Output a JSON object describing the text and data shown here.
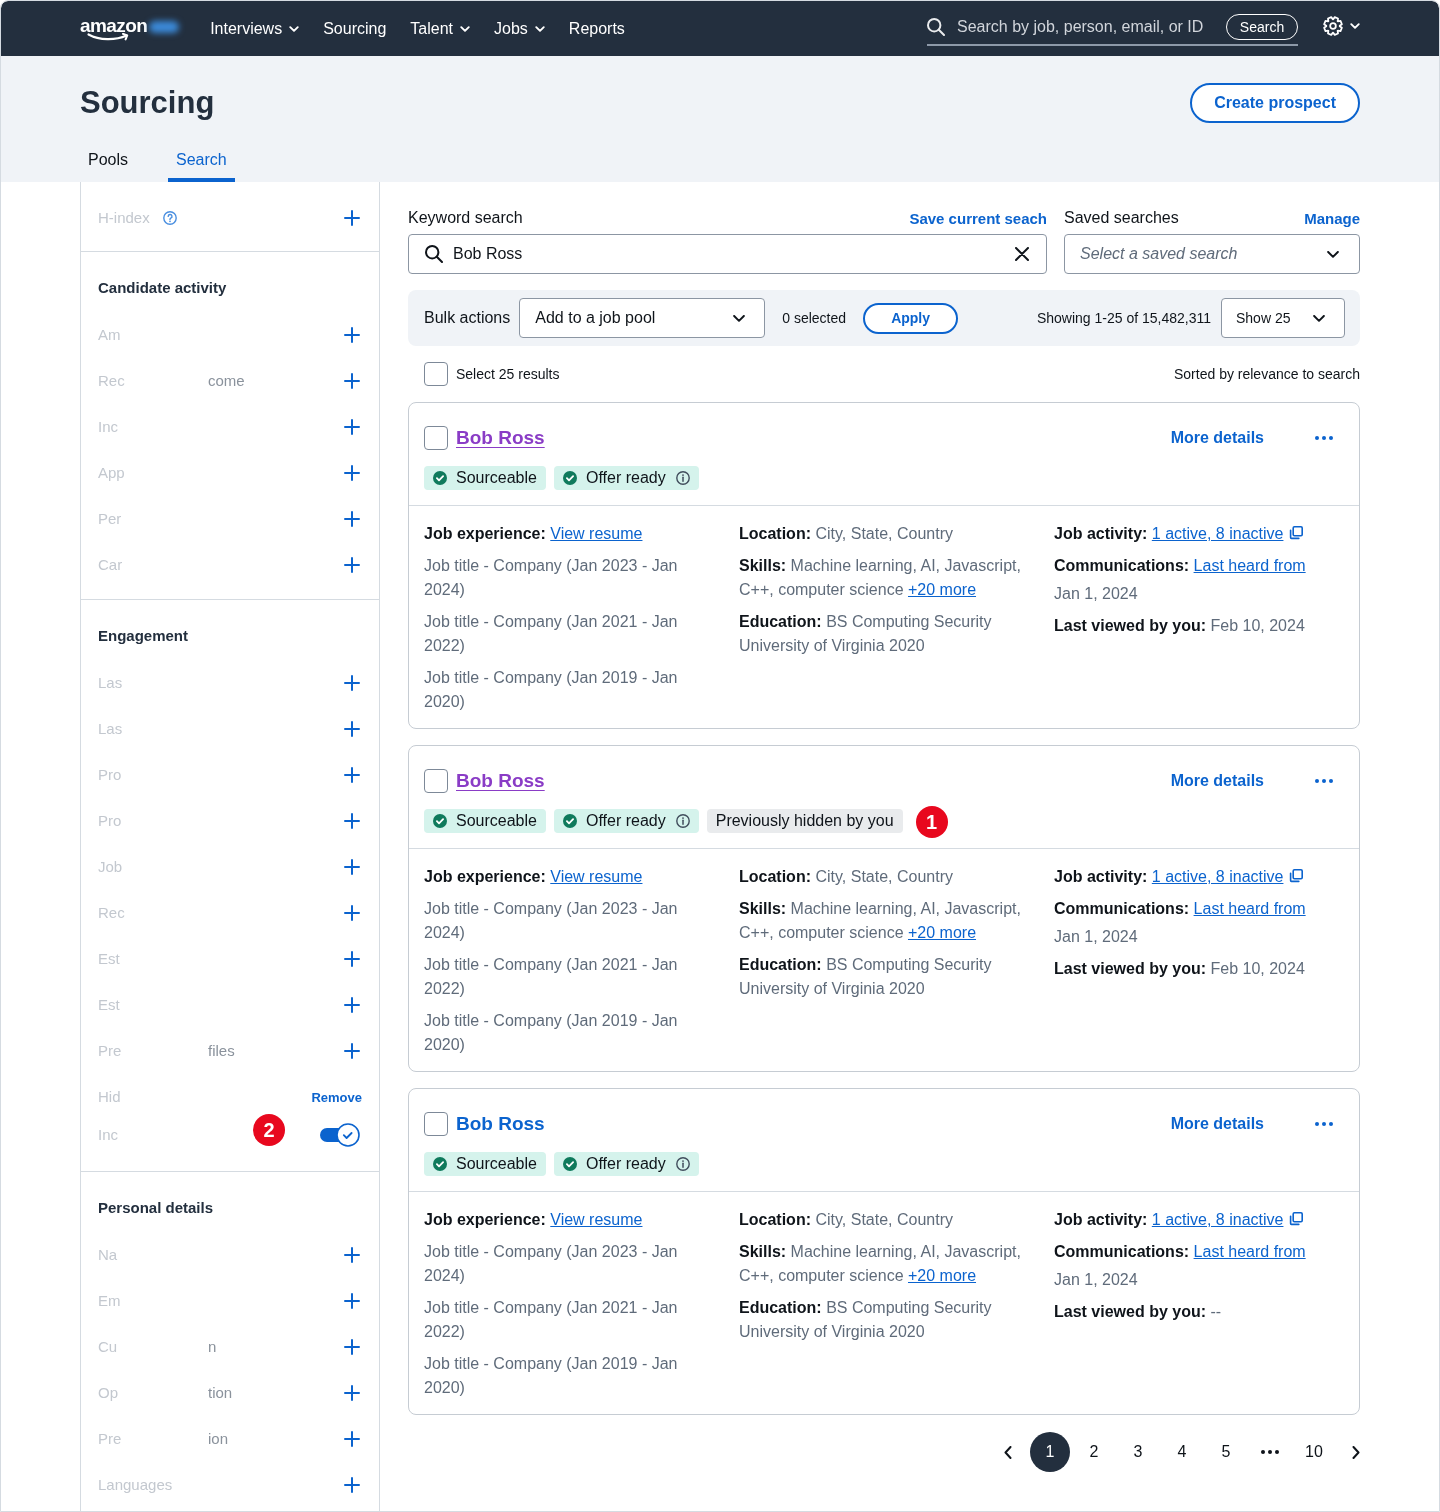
{
  "nav": {
    "logo": "amazon",
    "items": [
      {
        "label": "Interviews",
        "dropdown": true
      },
      {
        "label": "Sourcing",
        "dropdown": false
      },
      {
        "label": "Talent",
        "dropdown": true
      },
      {
        "label": "Jobs",
        "dropdown": true
      },
      {
        "label": "Reports",
        "dropdown": false
      }
    ],
    "search": {
      "placeholder": "Search by job, person, email, or ID",
      "button": "Search"
    }
  },
  "header": {
    "title": "Sourcing",
    "action": "Create prospect",
    "tabs": [
      {
        "label": "Pools",
        "selected": false
      },
      {
        "label": "Search",
        "selected": true
      }
    ]
  },
  "filters": {
    "sections": [
      {
        "items": [
          {
            "kind": "add",
            "label": "H-index",
            "help": true
          }
        ]
      },
      {
        "heading": "Candidate activity",
        "items": [
          {
            "kind": "add",
            "label": "Am"
          },
          {
            "kind": "add",
            "label": "Rec",
            "tail": "come"
          },
          {
            "kind": "add",
            "label": "Inc"
          },
          {
            "kind": "add",
            "label": "App"
          },
          {
            "kind": "add",
            "label": "Per"
          },
          {
            "kind": "add",
            "label": "Car"
          }
        ]
      },
      {
        "heading": "Engagement",
        "items": [
          {
            "kind": "add",
            "label": "Las"
          },
          {
            "kind": "add",
            "label": "Las"
          },
          {
            "kind": "add",
            "label": "Pro"
          },
          {
            "kind": "add",
            "label": "Pro"
          },
          {
            "kind": "add",
            "label": "Job"
          },
          {
            "kind": "add",
            "label": "Rec"
          },
          {
            "kind": "add",
            "label": "Est"
          },
          {
            "kind": "add",
            "label": "Est"
          },
          {
            "kind": "add",
            "label": "Pre",
            "tail": "files"
          },
          {
            "kind": "remove",
            "label": "Hid",
            "action": "Remove"
          },
          {
            "kind": "toggle",
            "label": "Inc",
            "on": true,
            "annotation": "2"
          }
        ]
      },
      {
        "heading": "Personal details",
        "items": [
          {
            "kind": "add",
            "label": "Na"
          },
          {
            "kind": "add",
            "label": "Em"
          },
          {
            "kind": "add",
            "label": "Cu",
            "tail": "n"
          },
          {
            "kind": "add",
            "label": "Op",
            "tail": "tion"
          },
          {
            "kind": "add",
            "label": "Pre",
            "tail": "ion"
          },
          {
            "kind": "add",
            "label": "Languages"
          }
        ]
      }
    ]
  },
  "keyword_search": {
    "label": "Keyword search",
    "link": "Save current seach",
    "value": "Bob Ross"
  },
  "saved_searches": {
    "label": "Saved searches",
    "link": "Manage",
    "placeholder": "Select a saved search"
  },
  "bulk_actions": {
    "label": "Bulk actions",
    "action": "Add to a job pool",
    "count": "0 selected",
    "button": "Apply",
    "showing": "Showing 1-25 of 15,482,311",
    "page_size": "Show 25"
  },
  "results": {
    "select_all": {
      "label": "Select 25 results",
      "checked": false
    },
    "sort": "Sorted by relevance to search",
    "cards": [
      {
        "name": "Bob Ross",
        "visited": true,
        "checked": false,
        "action": "More details",
        "tags": [
          {
            "kind": "status",
            "label": "Sourceable"
          },
          {
            "kind": "status",
            "label": "Offer ready",
            "info": true
          }
        ],
        "columns": [
          [
            {
              "label": "Job experience:",
              "link": "View resume"
            },
            {
              "value": "Job title - Company (Jan 2023 - Jan 2024)"
            },
            {
              "value": "Job title - Company (Jan 2021 - Jan 2022)"
            },
            {
              "value": "Job title - Company (Jan 2019 - Jan 2020)"
            }
          ],
          [
            {
              "label": "Location:",
              "value": "City, State, Country"
            },
            {
              "label": "Skills:",
              "value": "Machine learning, AI, Javascript, C++, computer science",
              "link": "+20 more"
            },
            {
              "label": "Education:",
              "value": "BS Computing Security University of Virginia 2020"
            }
          ],
          [
            {
              "label": "Job activity:",
              "link": "1 active, 8 inactive",
              "link_icon": true
            },
            {
              "label": "Communications:",
              "link": "Last heard from",
              "note": "Jan 1, 2024"
            },
            {
              "label": "Last viewed by you:",
              "value": "Feb 10, 2024"
            }
          ]
        ]
      },
      {
        "name": "Bob Ross",
        "visited": true,
        "checked": false,
        "action": "More details",
        "tags": [
          {
            "kind": "status",
            "label": "Sourceable"
          },
          {
            "kind": "status",
            "label": "Offer ready",
            "info": true
          },
          {
            "kind": "neutral",
            "label": "Previously hidden by you"
          }
        ],
        "annotation": "1",
        "columns": [
          [
            {
              "label": "Job experience:",
              "link": "View resume"
            },
            {
              "value": "Job title - Company (Jan 2023 - Jan 2024)"
            },
            {
              "value": "Job title - Company (Jan 2021 - Jan 2022)"
            },
            {
              "value": "Job title - Company (Jan 2019 - Jan 2020)"
            }
          ],
          [
            {
              "label": "Location:",
              "value": "City, State, Country"
            },
            {
              "label": "Skills:",
              "value": "Machine learning, AI, Javascript, C++, computer science",
              "link": "+20 more"
            },
            {
              "label": "Education:",
              "value": "BS Computing Security University of Virginia 2020"
            }
          ],
          [
            {
              "label": "Job activity:",
              "link": "1 active, 8 inactive",
              "link_icon": true
            },
            {
              "label": "Communications:",
              "link": "Last heard from",
              "note": "Jan 1, 2024"
            },
            {
              "label": "Last viewed by you:",
              "value": "Feb 10, 2024"
            }
          ]
        ]
      },
      {
        "name": "Bob Ross",
        "visited": false,
        "checked": false,
        "action": "More details",
        "tags": [
          {
            "kind": "status",
            "label": "Sourceable"
          },
          {
            "kind": "status",
            "label": "Offer ready",
            "info": true
          }
        ],
        "columns": [
          [
            {
              "label": "Job experience:",
              "link": "View resume"
            },
            {
              "value": "Job title - Company (Jan 2023 - Jan 2024)"
            },
            {
              "value": "Job title - Company (Jan 2021 - Jan 2022)"
            },
            {
              "value": "Job title - Company (Jan 2019 - Jan 2020)"
            }
          ],
          [
            {
              "label": "Location:",
              "value": "City, State, Country"
            },
            {
              "label": "Skills:",
              "value": "Machine learning, AI, Javascript, C++, computer science",
              "link": "+20 more"
            },
            {
              "label": "Education:",
              "value": "BS Computing Security University of Virginia 2020"
            }
          ],
          [
            {
              "label": "Job activity:",
              "link": "1 active, 8 inactive",
              "link_icon": true
            },
            {
              "label": "Communications:",
              "link": "Last heard from",
              "note": "Jan 1, 2024"
            },
            {
              "label": "Last viewed by you:",
              "value": "--"
            }
          ]
        ]
      }
    ]
  },
  "pagination": {
    "pages": [
      {
        "kind": "page",
        "label": "1",
        "selected": true
      },
      {
        "kind": "page",
        "label": "2",
        "selected": false
      },
      {
        "kind": "page",
        "label": "3",
        "selected": false
      },
      {
        "kind": "page",
        "label": "4",
        "selected": false
      },
      {
        "kind": "page",
        "label": "5",
        "selected": false
      },
      {
        "kind": "ellipsis"
      },
      {
        "kind": "page",
        "label": "10",
        "selected": false
      }
    ]
  }
}
